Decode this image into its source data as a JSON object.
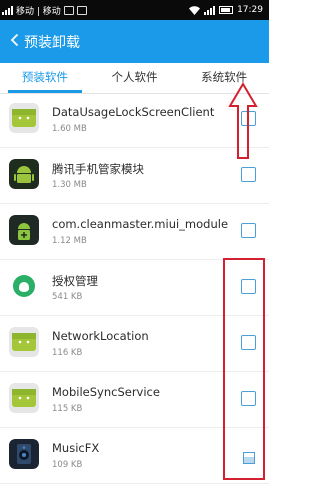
{
  "status_bar": {
    "carrier": "移动 | 移动",
    "time": "17:29",
    "icons": [
      "signal-icon",
      "image-icon",
      "notification-icon",
      "wifi-icon",
      "battery-icon"
    ]
  },
  "header": {
    "title": "预装卸载",
    "back_icon": "chevron-left-icon"
  },
  "tabs": [
    {
      "label": "预装软件",
      "active": true
    },
    {
      "label": "个人软件",
      "active": false
    },
    {
      "label": "系统软件",
      "active": false
    }
  ],
  "apps": [
    {
      "name": "DataUsageLockScreenClient",
      "size": "1.60 MB",
      "icon": "android-icon",
      "checked": false
    },
    {
      "name": "腾讯手机管家模块",
      "size": "1.30 MB",
      "icon": "android-icon",
      "checked": false
    },
    {
      "name": "com.cleanmaster.miui_module",
      "size": "1.12 MB",
      "icon": "cleanmaster-icon",
      "checked": false
    },
    {
      "name": "授权管理",
      "size": "541 KB",
      "icon": "permission-manager-icon",
      "checked": false
    },
    {
      "name": "NetworkLocation",
      "size": "116 KB",
      "icon": "android-icon",
      "checked": false
    },
    {
      "name": "MobileSyncService",
      "size": "115 KB",
      "icon": "android-icon",
      "checked": false
    },
    {
      "name": "MusicFX",
      "size": "109 KB",
      "icon": "speaker-icon",
      "checked": false
    }
  ],
  "colors": {
    "accent": "#1a9ae8",
    "annotation": "#d3212f"
  }
}
